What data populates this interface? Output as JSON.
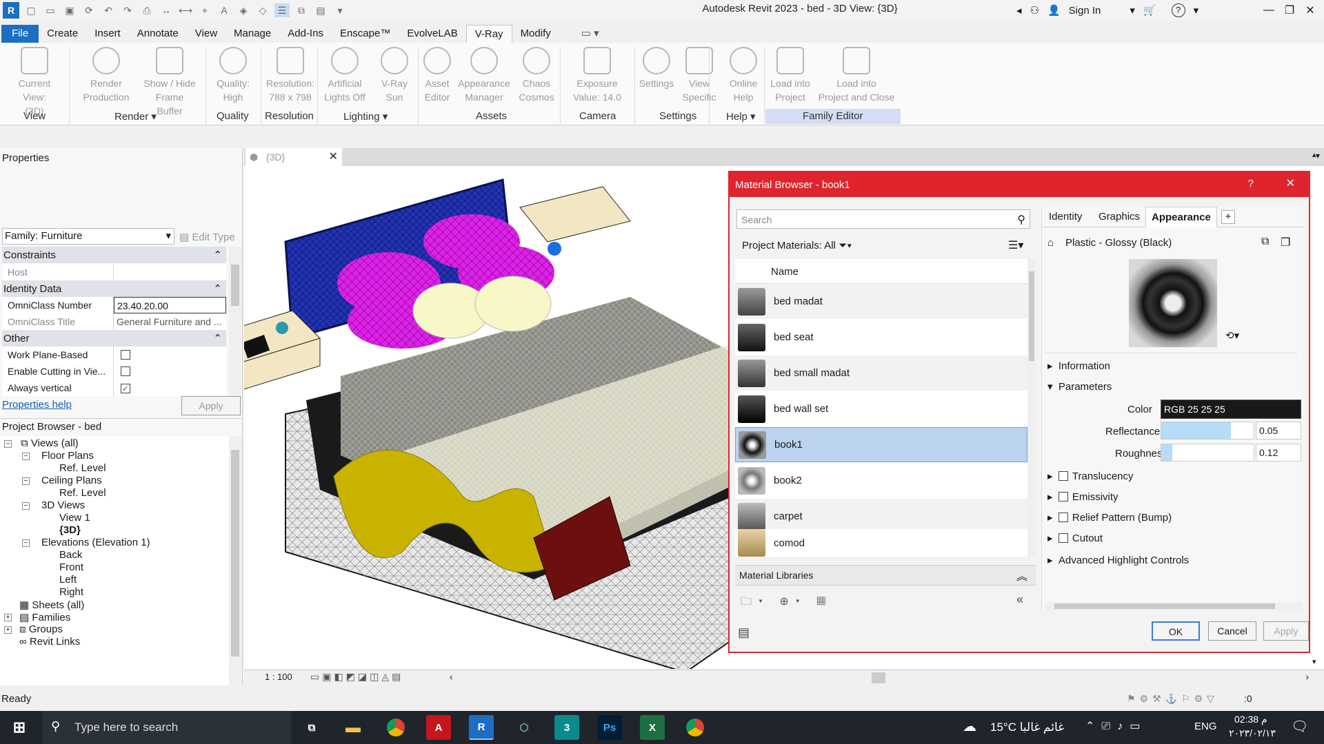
{
  "app": {
    "title": "Autodesk Revit 2023 - bed - 3D View: {3D}",
    "signin": "Sign In"
  },
  "menus": [
    "File",
    "Create",
    "Insert",
    "Annotate",
    "View",
    "Manage",
    "Add-Ins",
    "Enscape™",
    "EvolveLAB",
    "V-Ray",
    "Modify"
  ],
  "ribbon": {
    "buttons": [
      {
        "l1": "Current View:",
        "l2": "(3D)"
      },
      {
        "l1": "Render",
        "l2": "Production"
      },
      {
        "l1": "Show / Hide",
        "l2": "Frame Buffer"
      },
      {
        "l1": "Quality:",
        "l2": "High"
      },
      {
        "l1": "Resolution:",
        "l2": "788 x 798"
      },
      {
        "l1": "Artificial",
        "l2": "Lights Off"
      },
      {
        "l1": "V-Ray",
        "l2": "Sun"
      },
      {
        "l1": "Asset",
        "l2": "Editor"
      },
      {
        "l1": "Appearance",
        "l2": "Manager"
      },
      {
        "l1": "Chaos",
        "l2": "Cosmos"
      },
      {
        "l1": "Exposure",
        "l2": "Value: 14.0"
      },
      {
        "l1": "Settings",
        "l2": ""
      },
      {
        "l1": "View",
        "l2": "Specific"
      },
      {
        "l1": "Online",
        "l2": "Help"
      },
      {
        "l1": "Load into",
        "l2": "Project"
      },
      {
        "l1": "Load into",
        "l2": "Project and Close"
      }
    ],
    "groups": [
      "View",
      "Render",
      "Quality",
      "Resolution",
      "Lighting",
      "Assets",
      "Camera",
      "Settings",
      "Help",
      "Family Editor"
    ]
  },
  "properties": {
    "header": "Properties",
    "family": "Family: Furniture",
    "edit_type": "Edit Type",
    "sections": {
      "constraints": "Constraints",
      "identity": "Identity Data",
      "other": "Other"
    },
    "rows": {
      "host": "Host",
      "omni_num": "OmniClass Number",
      "omni_num_val": "23.40.20.00",
      "omni_title": "OmniClass Title",
      "omni_title_val": "General Furniture and ...",
      "wpb": "Work Plane-Based",
      "ecv": "Enable Cutting in Vie...",
      "av": "Always vertical",
      "av_check": "✓"
    },
    "help": "Properties help",
    "apply": "Apply"
  },
  "browser": {
    "header": "Project Browser - bed",
    "items": [
      "Views (all)",
      "Floor Plans",
      "Ref. Level",
      "Ceiling Plans",
      "Ref. Level",
      "3D Views",
      "View 1",
      "{3D}",
      "Elevations (Elevation 1)",
      "Back",
      "Front",
      "Left",
      "Right",
      "Sheets (all)",
      "Families",
      "Groups",
      "Revit Links"
    ]
  },
  "view": {
    "tab": "{3D}",
    "scale": "1 : 100"
  },
  "status": {
    "text": "Ready",
    "filter": ":0"
  },
  "material_browser": {
    "title": "Material Browser - book1",
    "help": "?",
    "search_placeholder": "Search",
    "filter_label": "Project Materials: All",
    "col_name": "Name",
    "materials": [
      "bed madat",
      "bed seat",
      "bed small madat",
      "bed wall set",
      "book1",
      "book2",
      "carpet",
      "comod"
    ],
    "libraries": "Material Libraries",
    "tabs": [
      "Identity",
      "Graphics",
      "Appearance"
    ],
    "appearance_name": "Plastic - Glossy (Black)",
    "information": "Information",
    "parameters": "Parameters",
    "color_label": "Color",
    "color_value": "RGB 25 25 25",
    "reflectance_label": "Reflectance",
    "reflectance_value": "0.05",
    "reflectance_fill": 0.75,
    "roughness_label": "Roughness",
    "roughness_value": "0.12",
    "roughness_fill": 0.12,
    "options": [
      "Translucency",
      "Emissivity",
      "Relief Pattern (Bump)",
      "Cutout",
      "Advanced Highlight Controls"
    ],
    "ok": "OK",
    "cancel": "Cancel",
    "apply": "Apply"
  },
  "taskbar": {
    "search_placeholder": "Type here to search",
    "weather": "15°C  غائم غالبا",
    "lang": "ENG",
    "time": "02:38 م",
    "date": "٢٠٢٣/٠٢/١٣"
  }
}
